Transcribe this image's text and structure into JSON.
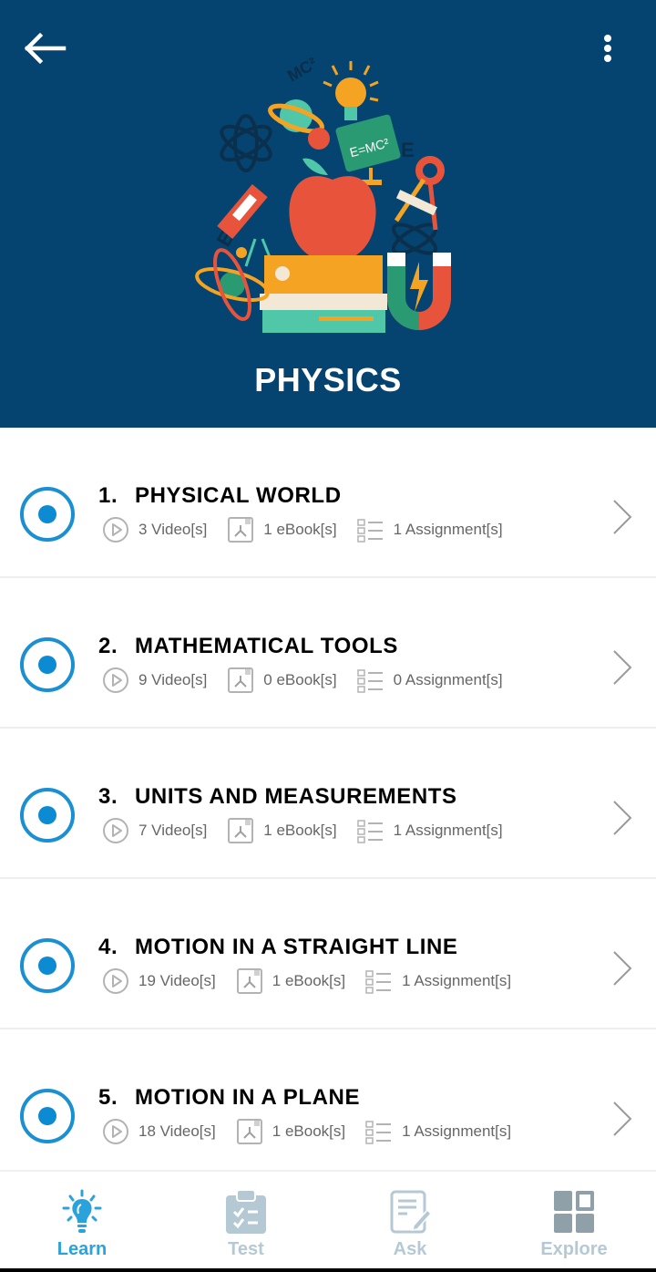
{
  "header": {
    "title": "PHYSICS",
    "back_icon": "arrow-left-icon",
    "more_icon": "more-vertical-icon",
    "background_color": "#054470"
  },
  "chapters": [
    {
      "number": "1.",
      "title": "PHYSICAL WORLD",
      "videos": "3 Video[s]",
      "ebooks": "1 eBook[s]",
      "assignments": "1 Assignment[s]"
    },
    {
      "number": "2.",
      "title": "MATHEMATICAL TOOLS",
      "videos": "9 Video[s]",
      "ebooks": "0 eBook[s]",
      "assignments": "0 Assignment[s]"
    },
    {
      "number": "3.",
      "title": "UNITS AND MEASUREMENTS",
      "videos": "7 Video[s]",
      "ebooks": "1 eBook[s]",
      "assignments": "1 Assignment[s]"
    },
    {
      "number": "4.",
      "title": "MOTION IN A STRAIGHT LINE",
      "videos": "19 Video[s]",
      "ebooks": "1 eBook[s]",
      "assignments": "1 Assignment[s]"
    },
    {
      "number": "5.",
      "title": "MOTION IN A PLANE",
      "videos": "18 Video[s]",
      "ebooks": "1 eBook[s]",
      "assignments": "1 Assignment[s]"
    }
  ],
  "bottom_nav": {
    "active_color": "#2aa3dc",
    "inactive_color": "#b5c9d4",
    "tabs": [
      {
        "label": "Learn",
        "icon": "lightbulb-icon",
        "active": true
      },
      {
        "label": "Test",
        "icon": "clipboard-checklist-icon",
        "active": false
      },
      {
        "label": "Ask",
        "icon": "document-pencil-icon",
        "active": false
      },
      {
        "label": "Explore",
        "icon": "grid-icon",
        "active": false
      }
    ]
  }
}
